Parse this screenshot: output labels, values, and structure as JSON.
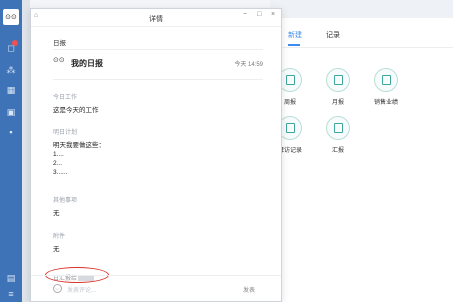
{
  "rail": {
    "avatar_text": "⊙⊙",
    "icons": [
      "chat-icon",
      "contacts-icon",
      "calendar-icon",
      "work-icon",
      "apps-icon",
      "files-icon",
      "menu-icon"
    ]
  },
  "modal": {
    "title": "详情",
    "controls": {
      "minimize": "−",
      "maximize": "□",
      "close": "×"
    },
    "breadcrumb": "日报",
    "report_logo": "⊙⊙",
    "report_title": "我的日报",
    "report_time": "今天 14:59",
    "sections": [
      {
        "label": "今日工作",
        "text": "这是今天的工作"
      },
      {
        "label": "明日计划",
        "text": "明天我要做这些：\n1....\n2...\n3......"
      },
      {
        "label": "其他事项",
        "text": "无"
      },
      {
        "label": "附件",
        "text": "无"
      }
    ],
    "recipient_label": "日汇报给",
    "comment_placeholder": "发表评论...",
    "send_label": "发表"
  },
  "right": {
    "tabs": [
      "新建",
      "记录"
    ],
    "active_tab": 0,
    "tiles": [
      {
        "label": "周报"
      },
      {
        "label": "月报"
      },
      {
        "label": "销售业绩"
      },
      {
        "label": "拜访记录"
      },
      {
        "label": "汇报"
      }
    ]
  },
  "colors": {
    "rail": "#3f73b8",
    "accent": "#3f8cf0",
    "tile": "#3fa79a",
    "annotation": "#d9302a"
  }
}
